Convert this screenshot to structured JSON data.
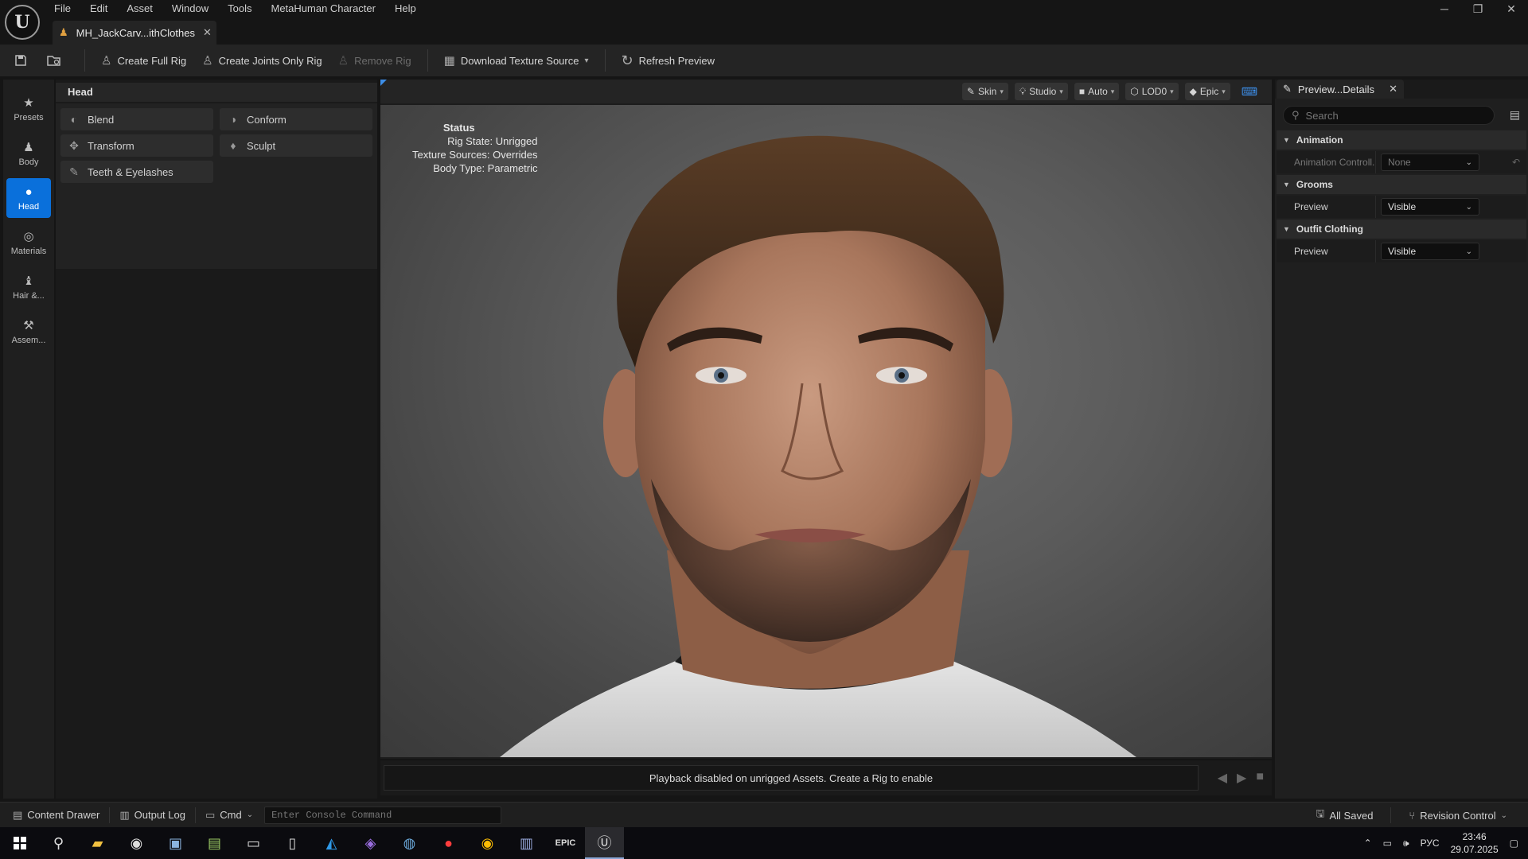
{
  "menu": [
    "File",
    "Edit",
    "Asset",
    "Window",
    "Tools",
    "MetaHuman Character",
    "Help"
  ],
  "document_tab": {
    "title": "MH_JackCarv...ithClothes"
  },
  "toolbar": {
    "create_full_rig": "Create Full Rig",
    "create_joints_only_rig": "Create Joints Only Rig",
    "remove_rig": "Remove Rig",
    "download_texture_source": "Download Texture Source",
    "refresh_preview": "Refresh Preview"
  },
  "left_nav": [
    {
      "label": "Presets",
      "icon": "star-icon"
    },
    {
      "label": "Body",
      "icon": "body-icon"
    },
    {
      "label": "Head",
      "icon": "head-icon",
      "active": true
    },
    {
      "label": "Materials",
      "icon": "materials-icon"
    },
    {
      "label": "Hair &...",
      "icon": "hair-icon"
    },
    {
      "label": "Assem...",
      "icon": "hammer-icon"
    }
  ],
  "tool_panel": {
    "title": "Head",
    "tools": [
      "Blend",
      "Conform",
      "Transform",
      "Sculpt",
      "Teeth & Eyelashes"
    ]
  },
  "viewport": {
    "options": [
      "Skin",
      "Studio",
      "Auto",
      "LOD0",
      "Epic"
    ],
    "status": {
      "title": "Status",
      "rig_state": "Rig State: Unrigged",
      "texture_sources": "Texture Sources: Overrides",
      "body_type": "Body Type: Parametric"
    },
    "playback_message": "Playback disabled on unrigged Assets. Create a Rig to enable"
  },
  "details": {
    "tab_title": "Preview...Details",
    "search_placeholder": "Search",
    "categories": [
      {
        "name": "Animation",
        "rows": [
          {
            "label": "Animation Controll...",
            "value": "None",
            "disabled": true
          }
        ]
      },
      {
        "name": "Grooms",
        "rows": [
          {
            "label": "Preview",
            "value": "Visible"
          }
        ]
      },
      {
        "name": "Outfit Clothing",
        "rows": [
          {
            "label": "Preview",
            "value": "Visible"
          }
        ]
      }
    ]
  },
  "statusbar": {
    "content_drawer": "Content Drawer",
    "output_log": "Output Log",
    "cmd": "Cmd",
    "console_placeholder": "Enter Console Command",
    "all_saved": "All Saved",
    "revision_control": "Revision Control"
  },
  "taskbar": {
    "language": "РУС",
    "time": "23:46",
    "date": "29.07.2025"
  },
  "colors": {
    "accent": "#0a70db",
    "background": "#151515",
    "panel": "#1f1f1f"
  }
}
